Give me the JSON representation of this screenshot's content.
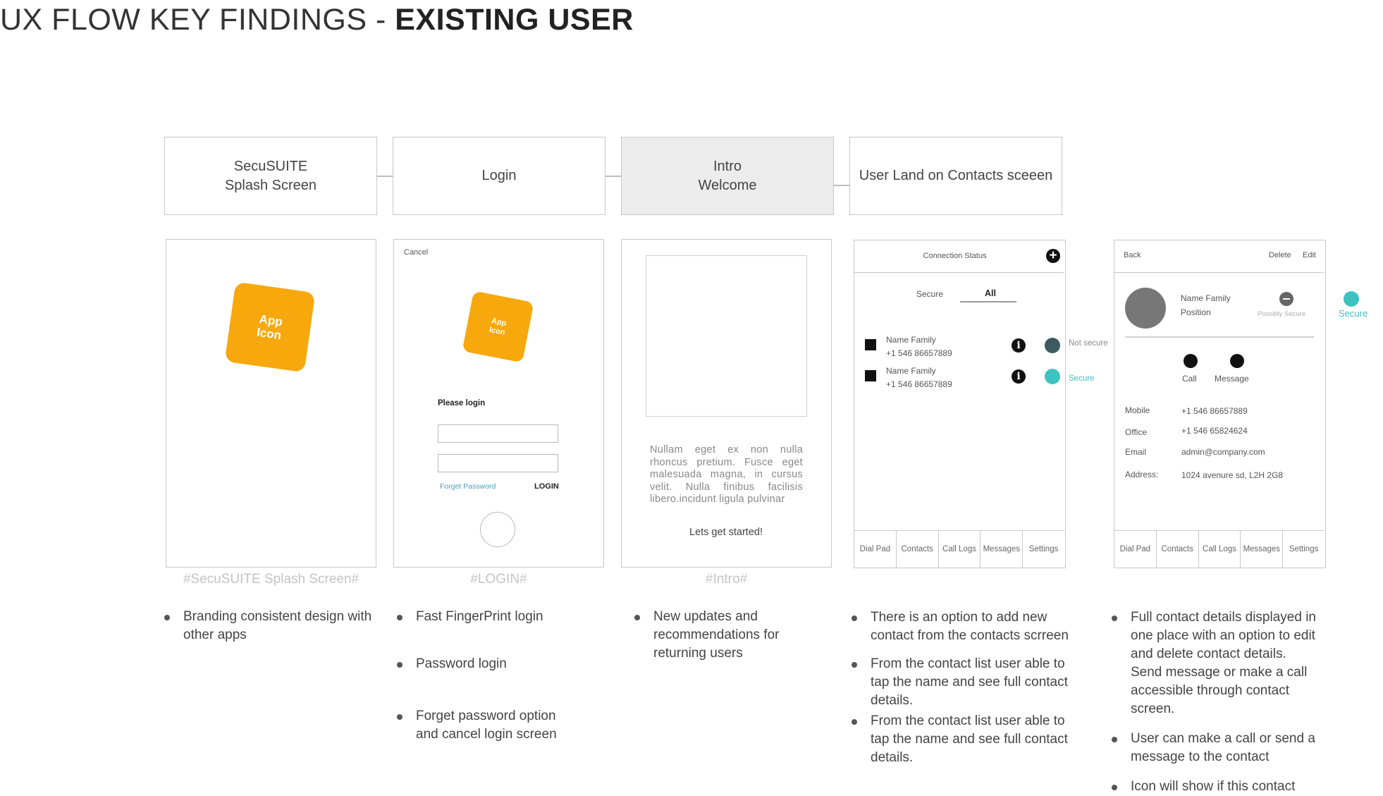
{
  "title": {
    "prefix": "UX FLOW KEY FINDINGS - ",
    "bold": "EXISTING USER"
  },
  "flow": [
    {
      "label": "SecuSUITE\nSplash Screen"
    },
    {
      "label": "Login"
    },
    {
      "label": "Intro\nWelcome"
    },
    {
      "label": "User Land on Contacts sceeen"
    }
  ],
  "splash": {
    "app_icon": "App\nIcon",
    "caption": "#SecuSUITE Splash Screen#"
  },
  "login": {
    "cancel": "Cancel",
    "app_icon": "App\nIcon",
    "please_login": "Please login",
    "forget_password": "Forget Password",
    "login_button": "LOGIN",
    "caption": "#LOGIN#"
  },
  "intro": {
    "body": "Nullam eget ex non nulla rhoncus pretium. Fusce eget malesuada magna, in cursus velit. Nulla finibus facilisis libero.incidunt ligula pulvinar",
    "cta": "Lets get started!",
    "caption": "#Intro#"
  },
  "contacts": {
    "header": "Connection Status",
    "tab_secure": "Secure",
    "tab_all": "All",
    "rows": [
      {
        "name": "Name Family",
        "phone": "+1 546 86657889",
        "status": "Not secure"
      },
      {
        "name": "Name Family",
        "phone": "+1 546 86657889",
        "status": "Secure"
      }
    ],
    "tabs": [
      "Dial Pad",
      "Contacts",
      "Call Logs",
      "Messages",
      "Settings"
    ]
  },
  "details": {
    "back": "Back",
    "delete": "Delete",
    "edit": "Edit",
    "name": "Name Family",
    "position": "Position",
    "possibly_secure": "Possibly Secure",
    "secure_legend": "Secure",
    "call": "Call",
    "message": "Message",
    "fields": [
      {
        "label": "Mobile",
        "value": "+1 546 86657889"
      },
      {
        "label": "Office",
        "value": "+1 546 65824624"
      },
      {
        "label": "Email",
        "value": "admin@company.com"
      },
      {
        "label": "Address:",
        "value": "1024 avenure sd, L2H 2G8"
      }
    ],
    "tabs": [
      "Dial Pad",
      "Contacts",
      "Call Logs",
      "Messages",
      "Settings"
    ]
  },
  "findings": {
    "splash": [
      "Branding consistent design with other apps"
    ],
    "login": [
      "Fast FingerPrint login",
      "Password login",
      "Forget password option and cancel login screen"
    ],
    "intro": [
      "New updates and recommendations for returning users"
    ],
    "contacts": [
      "There is an option to add new contact from the contacts scrreen",
      "From the contact list user able to tap the name and see full contact details.",
      "From the contact list user able to tap the name and see full contact details."
    ],
    "details": [
      "Full contact details displayed in one place with an option to edit and delete contact details. Send message or make a call accessible through contact screen.",
      "User can make a call or send a message to the contact",
      "Icon will show if this contact"
    ]
  },
  "colors": {
    "app_icon": "#f7a80c",
    "secure": "#3cc3c0",
    "not_secure": "#3d5a5e"
  }
}
